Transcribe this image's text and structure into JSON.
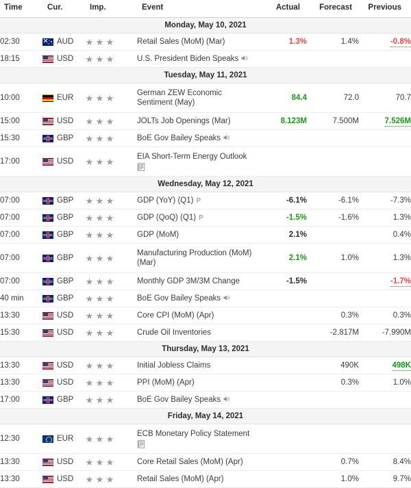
{
  "columns": {
    "time": "Time",
    "currency": "Cur.",
    "importance": "Imp.",
    "event": "Event",
    "actual": "Actual",
    "forecast": "Forecast",
    "previous": "Previous"
  },
  "colors": {
    "positive": "#179b17",
    "negative": "#ec4646",
    "neutral": "#3a3a3a",
    "day_header_bg": "#f4f4f4",
    "star": "#9d9d9d"
  },
  "groups": [
    {
      "date": "Monday, May 10, 2021",
      "rows": [
        {
          "time": "02:30",
          "currency": "AUD",
          "flag": "flag-aud",
          "stars": 3,
          "event": "Retail Sales (MoM) (Mar)",
          "prelim": "",
          "icon": "",
          "actual": "1.3%",
          "actual_state": "negative",
          "forecast": "1.4%",
          "forecast_state": "neutral",
          "previous": "-0.8%",
          "previous_state": "negative-underline"
        },
        {
          "time": "18:15",
          "currency": "USD",
          "flag": "flag-usd",
          "stars": 3,
          "event": "U.S. President Biden Speaks",
          "prelim": "",
          "icon": "speaker",
          "actual": "",
          "actual_state": "neutral",
          "forecast": "",
          "forecast_state": "neutral",
          "previous": "",
          "previous_state": "neutral"
        }
      ]
    },
    {
      "date": "Tuesday, May 11, 2021",
      "rows": [
        {
          "time": "10:00",
          "currency": "EUR",
          "flag": "flag-eur",
          "stars": 3,
          "event": "German ZEW Economic Sentiment (May)",
          "prelim": "",
          "icon": "",
          "actual": "84.4",
          "actual_state": "positive",
          "forecast": "72.0",
          "forecast_state": "neutral",
          "previous": "70.7",
          "previous_state": "neutral",
          "tall": true
        },
        {
          "time": "15:00",
          "currency": "USD",
          "flag": "flag-usd",
          "stars": 3,
          "event": "JOLTs Job Openings (Mar)",
          "prelim": "",
          "icon": "",
          "actual": "8.123M",
          "actual_state": "positive",
          "forecast": "7.500M",
          "forecast_state": "neutral",
          "previous": "7.526M",
          "previous_state": "positive-underline"
        },
        {
          "time": "15:30",
          "currency": "GBP",
          "flag": "flag-gbp",
          "stars": 3,
          "event": "BoE Gov Bailey Speaks",
          "prelim": "",
          "icon": "speaker",
          "actual": "",
          "actual_state": "neutral",
          "forecast": "",
          "forecast_state": "neutral",
          "previous": "",
          "previous_state": "neutral"
        },
        {
          "time": "17:00",
          "currency": "USD",
          "flag": "flag-usd",
          "stars": 3,
          "event": "EIA Short-Term Energy Outlook",
          "prelim": "",
          "icon": "doc",
          "actual": "",
          "actual_state": "neutral",
          "forecast": "",
          "forecast_state": "neutral",
          "previous": "",
          "previous_state": "neutral",
          "tall": true
        }
      ]
    },
    {
      "date": "Wednesday, May 12, 2021",
      "rows": [
        {
          "time": "07:00",
          "currency": "GBP",
          "flag": "flag-gbp",
          "stars": 3,
          "event": "GDP (YoY) (Q1)",
          "prelim": "P",
          "icon": "",
          "actual": "-6.1%",
          "actual_state": "bold",
          "forecast": "-6.1%",
          "forecast_state": "neutral",
          "previous": "-7.3%",
          "previous_state": "neutral"
        },
        {
          "time": "07:00",
          "currency": "GBP",
          "flag": "flag-gbp",
          "stars": 3,
          "event": "GDP (QoQ) (Q1)",
          "prelim": "P",
          "icon": "",
          "actual": "-1.5%",
          "actual_state": "positive",
          "forecast": "-1.6%",
          "forecast_state": "neutral",
          "previous": "1.3%",
          "previous_state": "neutral"
        },
        {
          "time": "07:00",
          "currency": "GBP",
          "flag": "flag-gbp",
          "stars": 3,
          "event": "GDP (MoM)",
          "prelim": "",
          "icon": "",
          "actual": "2.1%",
          "actual_state": "bold",
          "forecast": "",
          "forecast_state": "neutral",
          "previous": "0.4%",
          "previous_state": "neutral"
        },
        {
          "time": "07:00",
          "currency": "GBP",
          "flag": "flag-gbp",
          "stars": 3,
          "event": "Manufacturing Production (MoM) (Mar)",
          "prelim": "",
          "icon": "",
          "actual": "2.1%",
          "actual_state": "positive",
          "forecast": "1.0%",
          "forecast_state": "neutral",
          "previous": "1.3%",
          "previous_state": "neutral",
          "tall": true
        },
        {
          "time": "07:00",
          "currency": "GBP",
          "flag": "flag-gbp",
          "stars": 3,
          "event": "Monthly GDP 3M/3M Change",
          "prelim": "",
          "icon": "",
          "actual": "-1.5%",
          "actual_state": "bold",
          "forecast": "",
          "forecast_state": "neutral",
          "previous": "-1.7%",
          "previous_state": "negative-underline"
        },
        {
          "time": "40 min",
          "currency": "GBP",
          "flag": "flag-gbp",
          "stars": 3,
          "event": "BoE Gov Bailey Speaks",
          "prelim": "",
          "icon": "speaker",
          "actual": "",
          "actual_state": "neutral",
          "forecast": "",
          "forecast_state": "neutral",
          "previous": "",
          "previous_state": "neutral"
        },
        {
          "time": "13:30",
          "currency": "USD",
          "flag": "flag-usd",
          "stars": 3,
          "event": "Core CPI (MoM) (Apr)",
          "prelim": "",
          "icon": "",
          "actual": "",
          "actual_state": "neutral",
          "forecast": "0.3%",
          "forecast_state": "neutral",
          "previous": "0.3%",
          "previous_state": "neutral"
        },
        {
          "time": "15:30",
          "currency": "USD",
          "flag": "flag-usd",
          "stars": 3,
          "event": "Crude Oil Inventories",
          "prelim": "",
          "icon": "",
          "actual": "",
          "actual_state": "neutral",
          "forecast": "-2.817M",
          "forecast_state": "neutral",
          "previous": "-7.990M",
          "previous_state": "neutral"
        }
      ]
    },
    {
      "date": "Thursday, May 13, 2021",
      "rows": [
        {
          "time": "13:30",
          "currency": "USD",
          "flag": "flag-usd",
          "stars": 3,
          "event": "Initial Jobless Claims",
          "prelim": "",
          "icon": "",
          "actual": "",
          "actual_state": "neutral",
          "forecast": "490K",
          "forecast_state": "neutral",
          "previous": "498K",
          "previous_state": "positive-underline"
        },
        {
          "time": "13:30",
          "currency": "USD",
          "flag": "flag-usd",
          "stars": 3,
          "event": "PPI (MoM) (Apr)",
          "prelim": "",
          "icon": "",
          "actual": "",
          "actual_state": "neutral",
          "forecast": "0.3%",
          "forecast_state": "neutral",
          "previous": "1.0%",
          "previous_state": "neutral"
        },
        {
          "time": "17:00",
          "currency": "GBP",
          "flag": "flag-gbp",
          "stars": 3,
          "event": "BoE Gov Bailey Speaks",
          "prelim": "",
          "icon": "speaker",
          "actual": "",
          "actual_state": "neutral",
          "forecast": "",
          "forecast_state": "neutral",
          "previous": "",
          "previous_state": "neutral"
        }
      ]
    },
    {
      "date": "Friday, May 14, 2021",
      "rows": [
        {
          "time": "12:30",
          "currency": "EUR",
          "flag": "flag-eu",
          "stars": 3,
          "event": "ECB Monetary Policy Statement",
          "prelim": "",
          "icon": "doc",
          "actual": "",
          "actual_state": "neutral",
          "forecast": "",
          "forecast_state": "neutral",
          "previous": "",
          "previous_state": "neutral",
          "tall": true
        },
        {
          "time": "13:30",
          "currency": "USD",
          "flag": "flag-usd",
          "stars": 3,
          "event": "Core Retail Sales (MoM) (Apr)",
          "prelim": "",
          "icon": "",
          "actual": "",
          "actual_state": "neutral",
          "forecast": "0.7%",
          "forecast_state": "neutral",
          "previous": "8.4%",
          "previous_state": "neutral"
        },
        {
          "time": "13:30",
          "currency": "USD",
          "flag": "flag-usd",
          "stars": 3,
          "event": "Retail Sales (MoM) (Apr)",
          "prelim": "",
          "icon": "",
          "actual": "",
          "actual_state": "neutral",
          "forecast": "1.0%",
          "forecast_state": "neutral",
          "previous": "9.7%",
          "previous_state": "neutral"
        }
      ]
    }
  ]
}
